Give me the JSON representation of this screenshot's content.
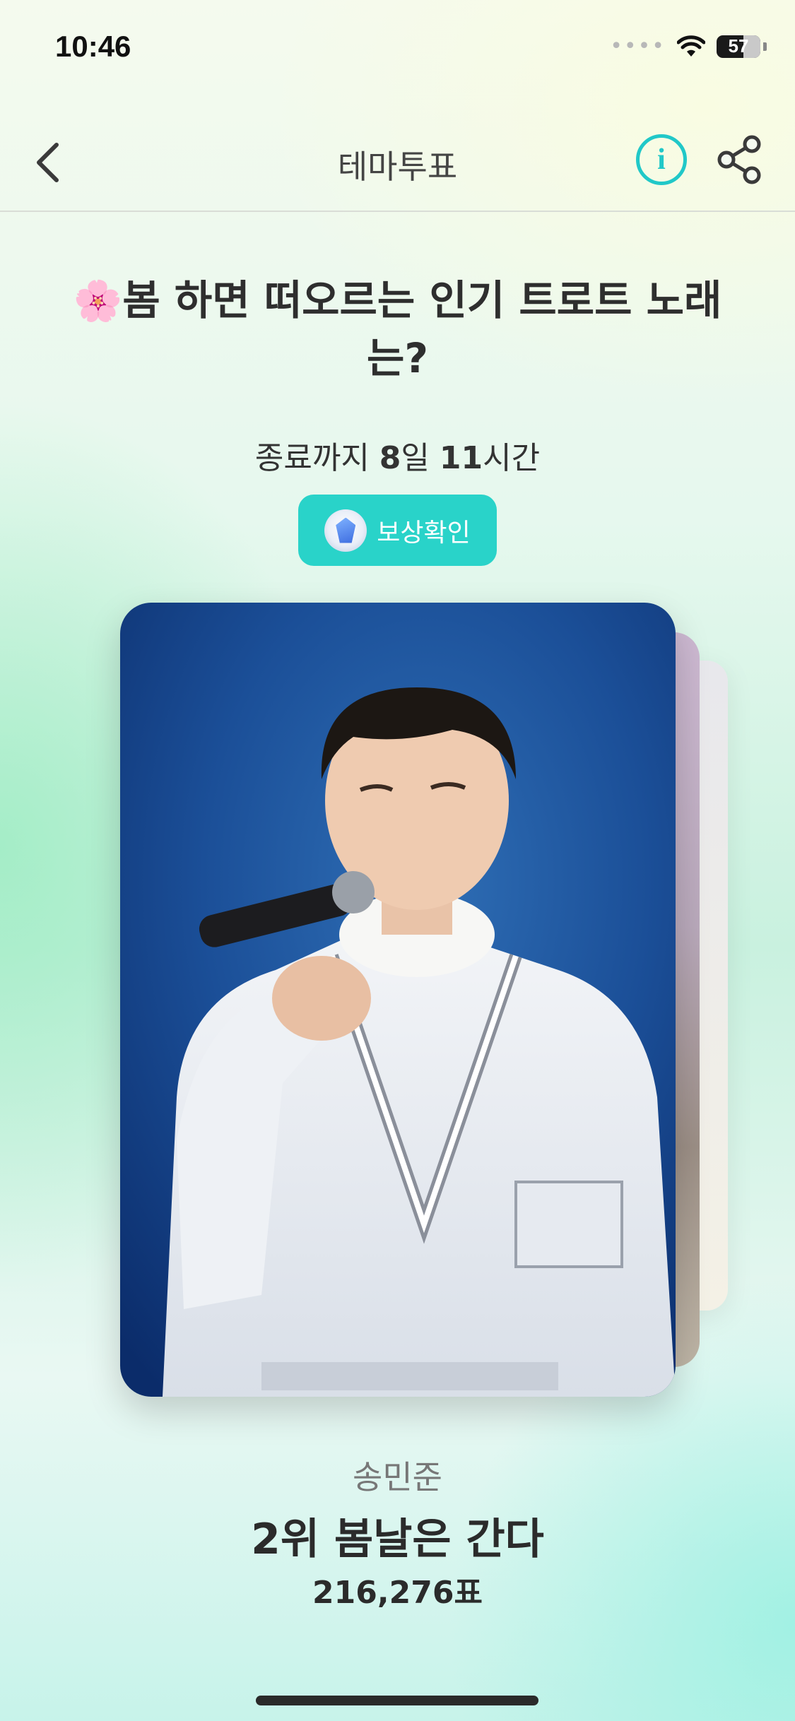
{
  "status": {
    "time": "10:46",
    "battery": "57"
  },
  "nav": {
    "title": "테마투표"
  },
  "vote": {
    "emoji": "🌸",
    "title": "봄 하면 떠오르는 인기 트로트 노래는?",
    "deadline_prefix": "종료까지 ",
    "days": "8",
    "days_unit": "일 ",
    "hours": "11",
    "hours_unit": "시간",
    "reward_label": "보상확인"
  },
  "candidate": {
    "artist": "송민준",
    "rank_title": "2위 봄날은 간다",
    "votes": "216,276표"
  },
  "icons": [
    "back-chevron-icon",
    "info-icon",
    "share-icon",
    "gem-icon",
    "wifi-icon",
    "battery-icon"
  ],
  "colors": {
    "accent": "#29d3c9",
    "info": "#21c8c8"
  }
}
